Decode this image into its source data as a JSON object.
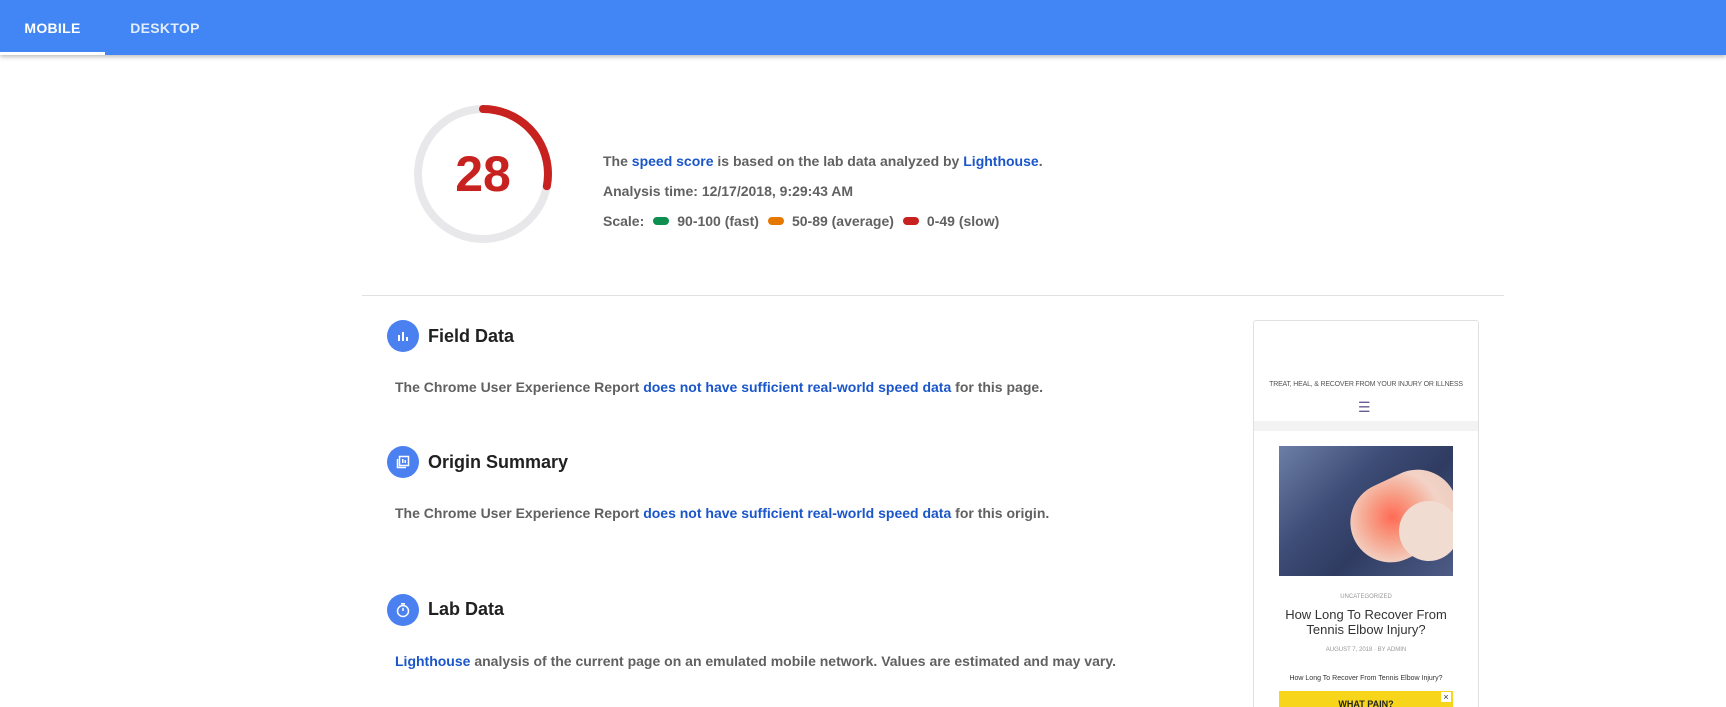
{
  "tabs": [
    {
      "label": "MOBILE",
      "active": true
    },
    {
      "label": "DESKTOP",
      "active": false
    }
  ],
  "score": {
    "value": "28",
    "fraction": 0.28,
    "color": "#c7221f",
    "intro_prefix": "The ",
    "speed_score_link": "speed score",
    "intro_middle": " is based on the lab data analyzed by ",
    "lighthouse_link": "Lighthouse",
    "intro_suffix": ".",
    "analysis_time": "Analysis time: 12/17/2018, 9:29:43 AM",
    "scale_label": "Scale:",
    "scale": [
      {
        "label": "90-100 (fast)",
        "color": "#0d904f"
      },
      {
        "label": "50-89 (average)",
        "color": "#e67700"
      },
      {
        "label": "0-49 (slow)",
        "color": "#c7221f"
      }
    ]
  },
  "field_data": {
    "title": "Field Data",
    "icon": "bar-chart-icon",
    "text_prefix": "The Chrome User Experience Report ",
    "link": "does not have sufficient real-world speed data",
    "text_suffix": " for this page."
  },
  "origin_summary": {
    "title": "Origin Summary",
    "icon": "library-icon",
    "text_prefix": "The Chrome User Experience Report ",
    "link": "does not have sufficient real-world speed data",
    "text_suffix": " for this origin."
  },
  "lab_data": {
    "title": "Lab Data",
    "icon": "stopwatch-icon",
    "link": "Lighthouse",
    "text_suffix": " analysis of the current page on an emulated mobile network. Values are estimated and may vary."
  },
  "screenshot": {
    "tagline": "TREAT, HEAL, & RECOVER FROM YOUR INJURY OR ILLNESS",
    "menu_icon": "hamburger-icon",
    "category": "UNCATEGORIZED",
    "title": "How Long To Recover From Tennis Elbow Injury?",
    "meta": "AUGUST 7, 2018 · BY ADMIN",
    "excerpt": "How Long To Recover From Tennis Elbow Injury?",
    "ad_text": "WHAT PAIN?",
    "ad_close": "×"
  }
}
